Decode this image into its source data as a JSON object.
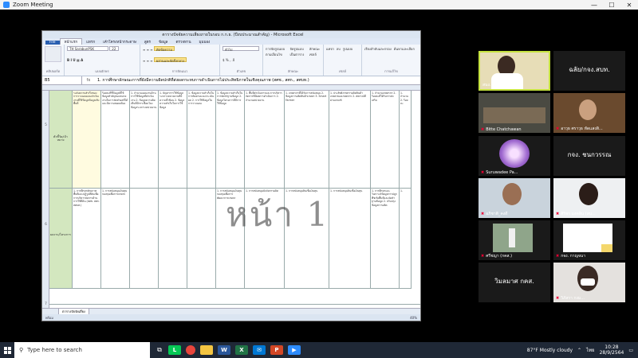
{
  "zoom": {
    "title": "Zoom Meeting",
    "minimize": "—",
    "maximize": "☐",
    "close": "✕"
  },
  "excel": {
    "title": "ตารางปัจจัยความเสี่ยงภายในรอบ ก.ก.ธ. (ปีงบประมาณสำคัญ) - Microsoft Excel",
    "tabs": [
      "File",
      "หน้าแรก",
      "แทรก",
      "เค้าโครงหน้ากระดาษ",
      "สูตร",
      "ข้อมูล",
      "ตรวจทาน",
      "มุมมอง"
    ],
    "font_name": "TH SarabunPSK",
    "font_size": "22",
    "cell_ref": "B5",
    "formula": "1. การศึกษาลักษณะการที่ยังมีความผิดปกติที่ส่งผลกระทบการดำเนินการไม่ประสิทธิภาพในเชิงคุณภาพ  (สศช., สศก., สศบท.)",
    "ribbon_groups": [
      "คลิปบอร์ด",
      "แบบอักษร",
      "การจัดแนว",
      "ตัวเลข",
      "ลักษณะ",
      "เซลล์",
      "การแก้ไข"
    ],
    "ribbon_buttons": {
      "wrap": "ตัดข้อความ",
      "merge": "ผสานและจัดกึ่งกลาง",
      "number": "ทั่วไป",
      "cond": "การจัดรูปแบบตามเงื่อนไข",
      "table": "จัดรูปแบบเป็นตาราง",
      "styles": "ลักษณะเซลล์",
      "insert": "แทรก",
      "delete": "ลบ",
      "format": "รูปแบบ",
      "sort": "เรียงลำดับและกรอง",
      "find": "ค้นหาและเลือก"
    },
    "row_labels": [
      "5",
      "6",
      "7"
    ],
    "label_col": {
      "r5": "ตัวชี้วัด/เป้าหมาย",
      "r6": "ผลงาน/โครงการ"
    },
    "row5_cells": [
      "ระดับความสำเร็จของการวางแผนและดำเนินงานที่ใช้ข้อมูลข้อมูลเชิงพื้นที่",
      "ร้อยละที่ชี้ข้อมูลที่ใช้ข้อมูลสำคัญของหน่วยงานในการจัดทำผลที่ได้ และมีความสอดคล้อง",
      "1. จำนวนแผนงานด้านการใช้ข้อมูลที่ดำเนินงาน 2. ข้อมูลความคิดเห็นที่มีการเชื่อมโยงข้อมูลระหว่างหน่วยงาน",
      "1. ปัญหาการใช้ข้อมูลระหว่างหน่วยงานที่มีความซ้ำซ้อน 2. ข้อมูลความสำเร็จในการใช้ข้อมูล",
      "1. ข้อมูลความสำเร็จในการติดตามและประเมินผล 2. การใช้ข้อมูลในการวางแผน",
      "1. ข้อมูลความสำเร็จในการจัดทำฐานข้อมูล 2. ข้อมูลโครงการที่มีการใช้ข้อมูล",
      "1. พื้นที่ดำเนินการและการบริหารจัดการที่มีผลการดำเนินการ 2. จำนวนหน่วยงาน",
      "1. เกษตรกรที่ได้รับการสนับสนุน 2. ข้อมูลการผลิตสินค้าเกษตร 3. Smart Farmer",
      "1. ประสิทธิภาพการผลิตสินค้าเกษตรของเกษตรกร 2. สหกรณ์ที่ผ่านเกณฑ์",
      "1. จำนวนเกษตรกร 2. ร้อยละที่ได้รับการส่งเสริม",
      "1. จำนวน 2. ร้อยละ"
    ],
    "row6_cells": [
      "1. การศึกษาศักยภาพพื้นที่และปฏิรูปที่ดินเพื่อการบริหารจัดการด้านการใช้ที่ดิน (สศช. สศก. สศบท.)",
      "1. การสนับสนุนเงินทุนกองทุนเพื่อการเกษตร",
      "",
      "",
      "",
      "1. การสนับสนุนเงินทุนกองทุนเพื่อการพัฒนาการเกษตร",
      "1. การสนับสนุนปัจจัยการผลิต",
      "1. การสนับสนุนสินเชื่อเงินทุน",
      "1. การสนับสนุนสินเชื่อเงินทุน",
      "1. การศึกษาและวิเคราะห์ข้อมูลการปลูกพืชเชิงพื้นที่และจัดทำฐานข้อมูล 2. ปรับปรุงข้อมูลการผลิต",
      "1."
    ],
    "watermark": "หน้า 1",
    "sheet_tab": "ตารางปัจจัยเสี่ยง",
    "status": "พร้อม",
    "zoom": "40%"
  },
  "participants": [
    {
      "name": "สนง. กขม. @วันเพ็ญ",
      "muted": false,
      "highlight": true
    },
    {
      "name": "ฉลัย/กจง.สบท.",
      "muted": true
    },
    {
      "name": "Bitte Chatchawan",
      "muted": true
    },
    {
      "name": "อาวุธ ศราวุธ หัดแสงสิ...",
      "muted": true
    },
    {
      "name": "Suruwadee Pa...",
      "muted": true
    },
    {
      "name": "กจง. ชนกวรรณ",
      "muted": true
    },
    {
      "name": "อภิชาติ_คงดี",
      "muted": true
    },
    {
      "name": "ศิริพร มงคลิน (สบ...",
      "muted": true
    },
    {
      "name": "ศรีชญา (กคส.)",
      "muted": true
    },
    {
      "name": "กจง. กาญจนา",
      "muted": true
    },
    {
      "name": "วิมลมาศ กคส.",
      "muted": true
    },
    {
      "name": "วิภัสรา กงม...",
      "muted": true
    }
  ],
  "taskbar": {
    "search_placeholder": "Type here to search",
    "weather": "87°F  Mostly cloudy",
    "lang": "ไทย",
    "time": "10:28",
    "date": "28/9/2564",
    "app_icons": [
      "line",
      "chrome",
      "file-explorer",
      "word",
      "excel",
      "mail",
      "powerpoint",
      "zoom"
    ]
  },
  "colors": {
    "zoom_bg": "#000000",
    "highlight": "#c5e23f",
    "green_cell": "#d3e7bf",
    "taskbar": "#1f2836"
  }
}
